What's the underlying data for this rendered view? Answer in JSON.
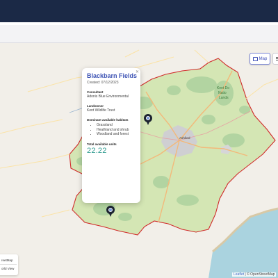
{
  "map": {
    "toggle_label": "Map",
    "toggle_icon": "map-icon",
    "layers_icon": "menu-icon",
    "attribution_leaflet": "Leaflet",
    "attribution_osm": "| © OpenStreetMap"
  },
  "labels": {
    "town": "Ashford",
    "north_downs_1": "Kent Do",
    "north_downs_2": "Natio",
    "north_downs_3": "Lands"
  },
  "popup": {
    "close_icon": "close-icon",
    "title": "Blackbarn Fields",
    "created": "Created: 07/12/2023",
    "consultant_label": "Consultant",
    "consultant_value": "Adonis Blue Environmental",
    "landowner_label": "Landowner",
    "landowner_value": "Kent Wildlife Trust",
    "habitats_label": "Dominant available habitats",
    "habitats": [
      "Grassland",
      "Heathland and shrub",
      "Woodland and forest"
    ],
    "total_label": "Total available units",
    "total_value": "22.22"
  },
  "layer_panel": {
    "item_1": "reetMap",
    "item_2": "orld View"
  },
  "colors": {
    "header": "#1b2946",
    "boundary": "#d12a2a",
    "accent": "#3f55b5",
    "units": "#2e9a8f",
    "sea": "#aad3df"
  }
}
